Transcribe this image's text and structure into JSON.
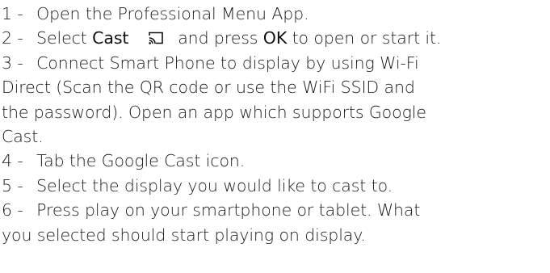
{
  "steps": [
    {
      "number": "1 -",
      "text": "Open the Professional Menu App."
    },
    {
      "number": "2 -",
      "text_before": "Select",
      "keyword_cast": "Cast",
      "icon": "cast-icon",
      "text_middle": "and press",
      "keyword_ok": "OK",
      "text_after": "to open or start it."
    },
    {
      "number": "3 -",
      "line1": "Connect Smart Phone to display by using Wi-Fi",
      "line2": "Direct (Scan the QR code or use the WiFi SSID and",
      "line3": "the password). Open an app which supports Google",
      "line4": "Cast."
    },
    {
      "number": "4 -",
      "text": "Tab the Google Cast icon."
    },
    {
      "number": "5 -",
      "text": "Select the display you would like to cast to."
    },
    {
      "number": "6 -",
      "line1": "Press play on your smartphone or tablet. What",
      "line2": "you selected should start playing on display."
    }
  ]
}
